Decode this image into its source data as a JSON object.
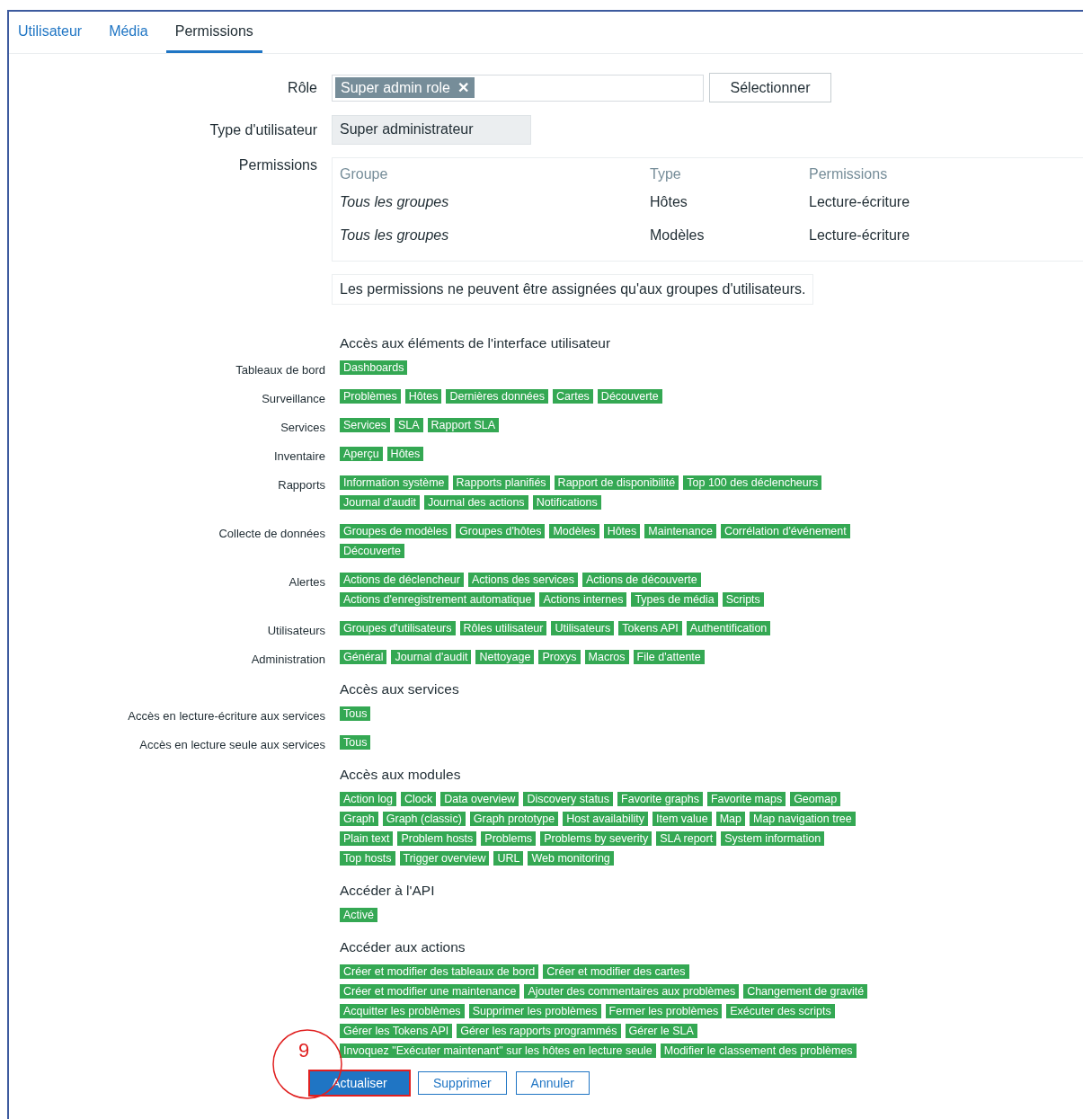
{
  "tabs": [
    {
      "label": "Utilisateur",
      "selected": false
    },
    {
      "label": "Média",
      "selected": false
    },
    {
      "label": "Permissions",
      "selected": true
    }
  ],
  "role": {
    "label": "Rôle",
    "chip": "Super admin role",
    "remove_icon": "✕",
    "button": "Sélectionner"
  },
  "user_type": {
    "label": "Type d'utilisateur",
    "value": "Super administrateur"
  },
  "permissions": {
    "label": "Permissions",
    "columns": [
      "Groupe",
      "Type",
      "Permissions"
    ],
    "rows": [
      [
        "Tous les groupes",
        "Hôtes",
        "Lecture-écriture"
      ],
      [
        "Tous les groupes",
        "Modèles",
        "Lecture-écriture"
      ]
    ],
    "note": "Les permissions ne peuvent être assignées qu'aux groupes d'utilisateurs."
  },
  "sections": [
    {
      "title": "Accès aux éléments de l'interface utilisateur",
      "rows": [
        {
          "label": "Tableaux de bord",
          "lines": [
            [
              "Dashboards"
            ]
          ]
        },
        {
          "label": "Surveillance",
          "lines": [
            [
              "Problèmes",
              "Hôtes",
              "Dernières données",
              "Cartes",
              "Découverte"
            ]
          ]
        },
        {
          "label": "Services",
          "lines": [
            [
              "Services",
              "SLA",
              "Rapport SLA"
            ]
          ]
        },
        {
          "label": "Inventaire",
          "lines": [
            [
              "Aperçu",
              "Hôtes"
            ]
          ]
        },
        {
          "label": "Rapports",
          "lines": [
            [
              "Information système",
              "Rapports planifiés",
              "Rapport de disponibilité",
              "Top 100 des déclencheurs"
            ],
            [
              "Journal d'audit",
              "Journal des actions",
              "Notifications"
            ]
          ]
        },
        {
          "label": "Collecte de données",
          "lines": [
            [
              "Groupes de modèles",
              "Groupes d'hôtes",
              "Modèles",
              "Hôtes",
              "Maintenance",
              "Corrélation d'événement"
            ],
            [
              "Découverte"
            ]
          ]
        },
        {
          "label": "Alertes",
          "lines": [
            [
              "Actions de déclencheur",
              "Actions des services",
              "Actions de découverte"
            ],
            [
              "Actions d'enregistrement automatique",
              "Actions internes",
              "Types de média",
              "Scripts"
            ]
          ]
        },
        {
          "label": "Utilisateurs",
          "lines": [
            [
              "Groupes d'utilisateurs",
              "Rôles utilisateur",
              "Utilisateurs",
              "Tokens API",
              "Authentification"
            ]
          ]
        },
        {
          "label": "Administration",
          "lines": [
            [
              "Général",
              "Journal d'audit",
              "Nettoyage",
              "Proxys",
              "Macros",
              "File d'attente"
            ]
          ]
        }
      ]
    },
    {
      "title": "Accès aux services",
      "rows": [
        {
          "label": "Accès en lecture-écriture aux services",
          "lines": [
            [
              "Tous"
            ]
          ]
        },
        {
          "label": "Accès en lecture seule aux services",
          "lines": [
            [
              "Tous"
            ]
          ]
        }
      ]
    },
    {
      "title": "Accès aux modules",
      "rows": [
        {
          "lines": [
            [
              "Action log",
              "Clock",
              "Data overview",
              "Discovery status",
              "Favorite graphs",
              "Favorite maps",
              "Geomap"
            ],
            [
              "Graph",
              "Graph (classic)",
              "Graph prototype",
              "Host availability",
              "Item value",
              "Map",
              "Map navigation tree"
            ],
            [
              "Plain text",
              "Problem hosts",
              "Problems",
              "Problems by severity",
              "SLA report",
              "System information"
            ],
            [
              "Top hosts",
              "Trigger overview",
              "URL",
              "Web monitoring"
            ]
          ]
        }
      ]
    },
    {
      "title": "Accéder à l'API",
      "rows": [
        {
          "lines": [
            [
              "Activé"
            ]
          ]
        }
      ]
    },
    {
      "title": "Accéder aux actions",
      "rows": [
        {
          "lines": [
            [
              "Créer et modifier des tableaux de bord",
              "Créer et modifier des cartes"
            ],
            [
              "Créer et modifier une maintenance",
              "Ajouter des commentaires aux problèmes",
              "Changement de gravité"
            ],
            [
              "Acquitter les problèmes",
              "Supprimer les problèmes",
              "Fermer les problèmes",
              "Exécuter des scripts"
            ],
            [
              "Gérer les Tokens API",
              "Gérer les rapports programmés",
              "Gérer le SLA"
            ],
            [
              "Invoquez \"Exécuter maintenant\" sur les hôtes en lecture seule",
              "Modifier le classement des problèmes"
            ]
          ]
        }
      ]
    }
  ],
  "buttons": [
    {
      "label": "Actualiser",
      "kind": "primary",
      "highlighted": true
    },
    {
      "label": "Supprimer",
      "kind": "secondary",
      "highlighted": false
    },
    {
      "label": "Annuler",
      "kind": "secondary",
      "highlighted": false
    }
  ],
  "callout": {
    "number": "9"
  }
}
